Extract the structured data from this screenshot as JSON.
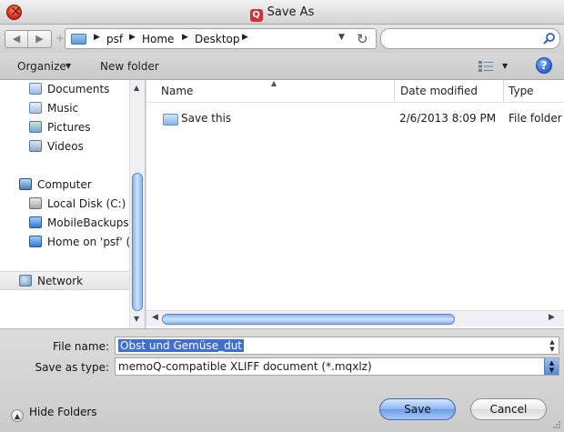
{
  "window": {
    "title": "Save As",
    "app_icon": "memoq-app-icon"
  },
  "navigation": {
    "back_icon": "back-arrow-icon",
    "forward_icon": "forward-arrow-icon",
    "breadcrumb": [
      "psf",
      "Home",
      "Desktop"
    ],
    "search_placeholder": ""
  },
  "commandbar": {
    "organize": "Organize",
    "new_folder": "New folder"
  },
  "nav_pane": {
    "libraries": [
      "Documents",
      "Music",
      "Pictures",
      "Videos"
    ],
    "computer": "Computer",
    "drives": [
      "Local Disk (C:)",
      "MobileBackups on 'psf' (Y:)",
      "Home on 'psf' (Z:)"
    ],
    "network": "Network"
  },
  "file_list": {
    "columns": [
      "Name",
      "Date modified",
      "Type"
    ],
    "rows": [
      {
        "name": "Save this",
        "date": "2/6/2013 8:09 PM",
        "type": "File folder"
      }
    ]
  },
  "form": {
    "file_name_label": "File name:",
    "file_name_value": "Obst und Gemüse_dut",
    "save_type_label": "Save as type:",
    "save_type_value": "memoQ-compatible XLIFF document (*.mqxlz)"
  },
  "footer": {
    "hide_folders": "Hide Folders",
    "save": "Save",
    "cancel": "Cancel"
  },
  "colors": {
    "selection": "#3f6fd1",
    "scroll_thumb": "#8fb4ea",
    "close_button": "#d52b13"
  }
}
